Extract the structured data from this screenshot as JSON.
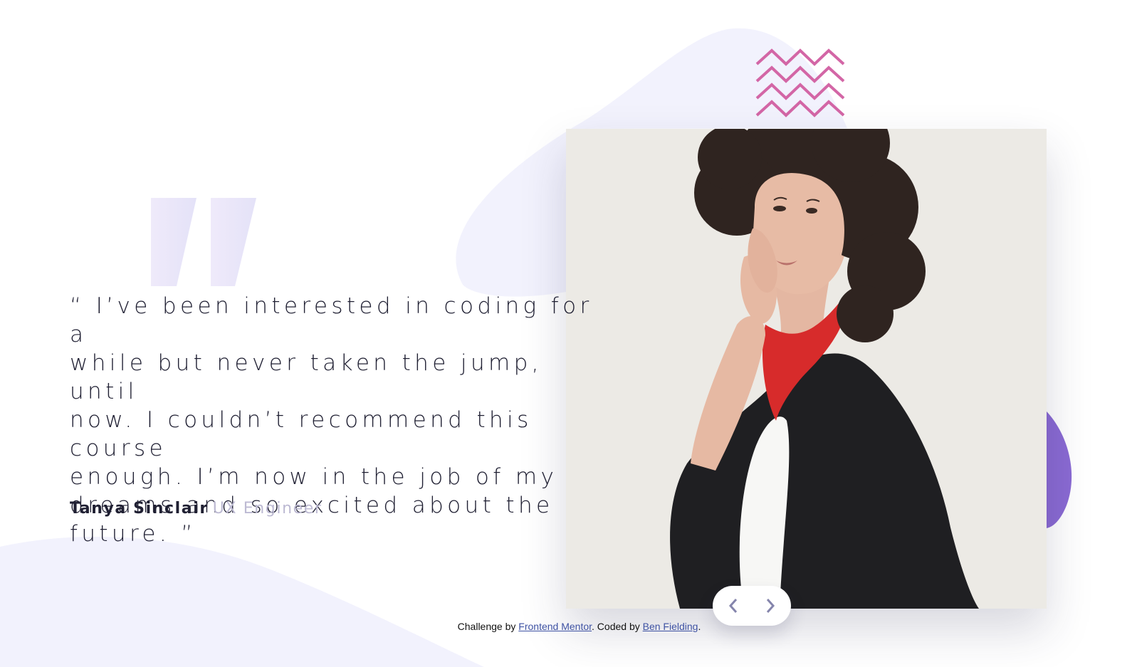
{
  "testimonial": {
    "quote_lines": [
      "“ I’ve been interested in coding for a",
      "while but never taken the jump, until",
      "now. I couldn’t recommend this course",
      "enough. I’m now in the job of my",
      "dreams and so excited about the",
      "future. ”"
    ],
    "author_name": "Tanya Sinclair",
    "author_role": "UX Engineer"
  },
  "navigation": {
    "prev_icon": "chevron-left-icon",
    "next_icon": "chevron-right-icon"
  },
  "footer": {
    "prefix": "Challenge by",
    "link1": "Frontend Mentor",
    "middle": ". Coded by",
    "link2": "Ben Fielding",
    "suffix": "."
  },
  "colors": {
    "background": "#ffffff",
    "blob": "#f2f2fd",
    "accent_purple": "#8a6ad3",
    "zigzag_pink": "#d366a6",
    "text_dark": "#202033",
    "role_gray": "#bdbad3",
    "link_blue": "#3e52a3"
  }
}
